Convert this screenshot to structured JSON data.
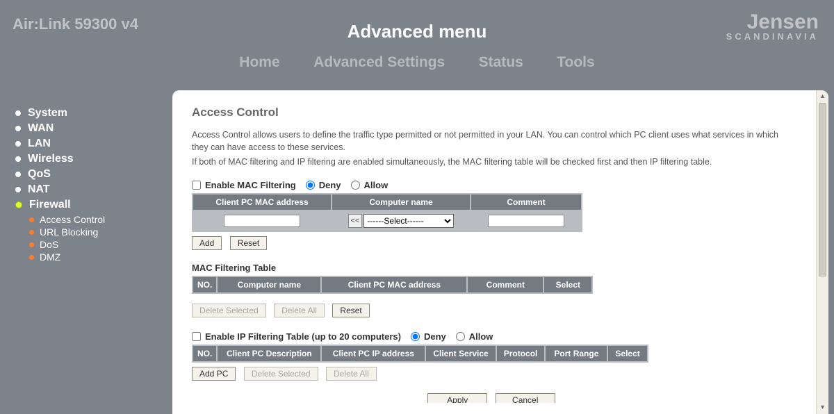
{
  "header": {
    "product": "Air:Link 59300 v4",
    "title": "Advanced menu",
    "logo_brand": "Jensen",
    "logo_sub": "SCANDINAVIA"
  },
  "topnav": [
    "Home",
    "Advanced Settings",
    "Status",
    "Tools"
  ],
  "sidebar": {
    "items": [
      {
        "label": "System"
      },
      {
        "label": "WAN"
      },
      {
        "label": "LAN"
      },
      {
        "label": "Wireless"
      },
      {
        "label": "QoS"
      },
      {
        "label": "NAT"
      },
      {
        "label": "Firewall"
      }
    ],
    "sub_items": [
      "Access Control",
      "URL Blocking",
      "DoS",
      "DMZ"
    ]
  },
  "main": {
    "title": "Access Control",
    "desc1": "Access Control allows users to define the traffic type permitted or not permitted in your LAN. You can control which PC client uses what services in which they can have access to these services.",
    "desc2": "If both of MAC filtering and IP filtering are enabled simultaneously, the MAC filtering table will be checked first and then IP filtering table.",
    "mac": {
      "enable_label": "Enable MAC Filtering",
      "deny": "Deny",
      "allow": "Allow",
      "cols": [
        "Client PC MAC address",
        "Computer name",
        "Comment"
      ],
      "select_placeholder": "------Select------",
      "add_btn": "Add",
      "reset_btn": "Reset",
      "table_heading": "MAC Filtering Table",
      "table_cols": [
        "NO.",
        "Computer name",
        "Client PC MAC address",
        "Comment",
        "Select"
      ],
      "delete_selected": "Delete Selected",
      "delete_all": "Delete All",
      "reset2": "Reset"
    },
    "ip": {
      "enable_label": "Enable IP Filtering Table (up to 20 computers)",
      "deny": "Deny",
      "allow": "Allow",
      "cols": [
        "NO.",
        "Client PC Description",
        "Client PC IP address",
        "Client Service",
        "Protocol",
        "Port Range",
        "Select"
      ],
      "add_pc": "Add PC",
      "delete_selected": "Delete Selected",
      "delete_all": "Delete All"
    },
    "footer": {
      "apply": "Apply",
      "cancel": "Cancel"
    }
  }
}
